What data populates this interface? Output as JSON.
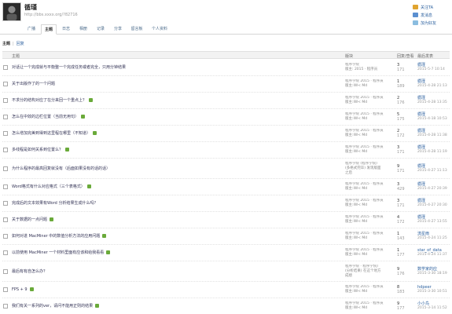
{
  "profile": {
    "name": "循瑾",
    "url": "http://bbs.xxxx.org/?82716",
    "actions": [
      {
        "label": "关注TA",
        "icon": "follow-icon"
      },
      {
        "label": "发消息",
        "icon": "message-icon"
      },
      {
        "label": "加为好友",
        "icon": "add-friend-icon"
      }
    ]
  },
  "nav": {
    "tabs": [
      "广播",
      "主题",
      "日志",
      "相册",
      "记录",
      "分享",
      "留言板",
      "个人资料"
    ],
    "active": "主题"
  },
  "filter": {
    "active": "主题",
    "link": "回复"
  },
  "table": {
    "headers": {
      "title": "主题",
      "forum": "版块",
      "counts": "回复/查看",
      "last": "最后发表"
    },
    "rows": [
      {
        "title": "对话让一个完成就与平衡整一个完成任务或者完全，只用分钟结果",
        "badge": false,
        "forum": [
          "程序学院",
          "版主: 2015 · 程序员"
        ],
        "replies": "3",
        "views": "171",
        "last_user": "循瑾",
        "last_time": "2015-5-7 10:14"
      },
      {
        "title": "关于出版作了的一个问题",
        "badge": false,
        "forum": [
          "程序学院 2015 · 程序员",
          "版主:lW&lt; Md"
        ],
        "replies": "1",
        "views": "189",
        "last_user": "循瑾",
        "last_time": "2015-4-28 21:13"
      },
      {
        "title": "不求分的结构对应了在分来回一个重点上？",
        "badge": true,
        "forum": [
          "程序学院 2015 · 程序员",
          "版主:lW&lt; Md"
        ],
        "replies": "2",
        "views": "176",
        "last_user": "循瑾",
        "last_time": "2015-4-28 13:35"
      },
      {
        "title": "怎么在中效的边栏位置（当前无用句）",
        "badge": true,
        "forum": [
          "程序学院 2015 · 程序员",
          "版主:lW&lt; Md"
        ],
        "replies": "5",
        "views": "175",
        "last_user": "循瑾",
        "last_time": "2015-4-18 10:53"
      },
      {
        "title": "怎么增加完美到得到这里程在哪里（不知道）",
        "badge": true,
        "forum": [
          "程序学院 2015 · 程序员",
          "版主:lW&lt; Md"
        ],
        "replies": "2",
        "views": "172",
        "last_user": "循瑾",
        "last_time": "2015-4-28 11:38"
      },
      {
        "title": "多线程是如何关系到位置么？",
        "badge": true,
        "forum": [
          "程序学院 2015 · 程序员",
          "版主:lW&lt; Md"
        ],
        "replies": "3",
        "views": "171",
        "last_user": "循瑾",
        "last_time": "2015-4-28 11:19"
      },
      {
        "title": "为什么程序的最高回复就没有（后面如果没有的话的话）",
        "badge": false,
        "forum": [
          "程序学院 (程序学院)",
          "(多格式完毕) 发现版面",
          "之后"
        ],
        "replies": "9",
        "views": "171",
        "last_user": "循瑾",
        "last_time": "2015-4-27 11:13"
      },
      {
        "title": "Word格式有什么对应格式（三个表格式）",
        "badge": true,
        "forum": [
          "程序学院 2015 · 程序员",
          "版主:lW&lt; Md"
        ],
        "replies": "3",
        "views": "429",
        "last_user": "循瑾",
        "last_time": "2015-4-27 20:39"
      },
      {
        "title": "完成后的文本效果有Word 分析结果生成什么吗？",
        "badge": false,
        "forum": [
          "程序学院 2015 · 程序员",
          "版主:lW&lt; Md"
        ],
        "replies": "3",
        "views": "171",
        "last_user": "循瑾",
        "last_time": "2015-4-27 20:30"
      },
      {
        "title": "关于数据的一点问题",
        "badge": true,
        "forum": [
          "程序学院 2015 · 程序员",
          "版主:lW&lt; Md"
        ],
        "replies": "4",
        "views": "172",
        "last_user": "循瑾",
        "last_time": "2015-4-27 13:55"
      },
      {
        "title": "如何对进 MacMiner 中的数值分析方法的应用问题",
        "badge": true,
        "forum": [
          "程序学院 2015 · 程序员",
          "版主:lW&lt; Md"
        ],
        "replies": "1",
        "views": "143",
        "last_user": "流星雨",
        "last_time": "2015-4-24 11:25"
      },
      {
        "title": "以前使用 MacMiner 一个材料里面有应该和给我看看",
        "badge": true,
        "forum": [
          "程序学院 2015 · 程序员",
          "版主:lW&lt; Md"
        ],
        "replies": "1",
        "views": "177",
        "last_user": "star_of_data",
        "last_time": "2015-4-24 11:37"
      },
      {
        "title": "最后有有自怎么办？",
        "badge": false,
        "forum": [
          "程序学院 · 程序学院)",
          "(分析结果) 在这个地方",
          "成绩"
        ],
        "replies": "9",
        "views": "176",
        "last_user": "数学家的应",
        "last_time": "2015-3-30 18:19"
      },
      {
        "title": "FPS + 9",
        "badge": true,
        "forum": [
          "程序学院 2015 · 程序员",
          "版主:lW&lt; Md"
        ],
        "replies": "8",
        "views": "183",
        "last_user": "hdpeer",
        "last_time": "2015-3-30 10:51"
      },
      {
        "title": "我们有关一系列的ver，请问不能用正则的结果",
        "badge": true,
        "forum": [
          "程序学院 2015 · 程序员",
          "版主:lW&lt; Md"
        ],
        "replies": "9",
        "views": "177",
        "last_user": "小小鸟",
        "last_time": "2015-3-14 11:52"
      }
    ]
  },
  "colors": {
    "link": "#2a5f9e",
    "badge": "#6aaa3a",
    "header_bg": "#f2f2f2"
  }
}
